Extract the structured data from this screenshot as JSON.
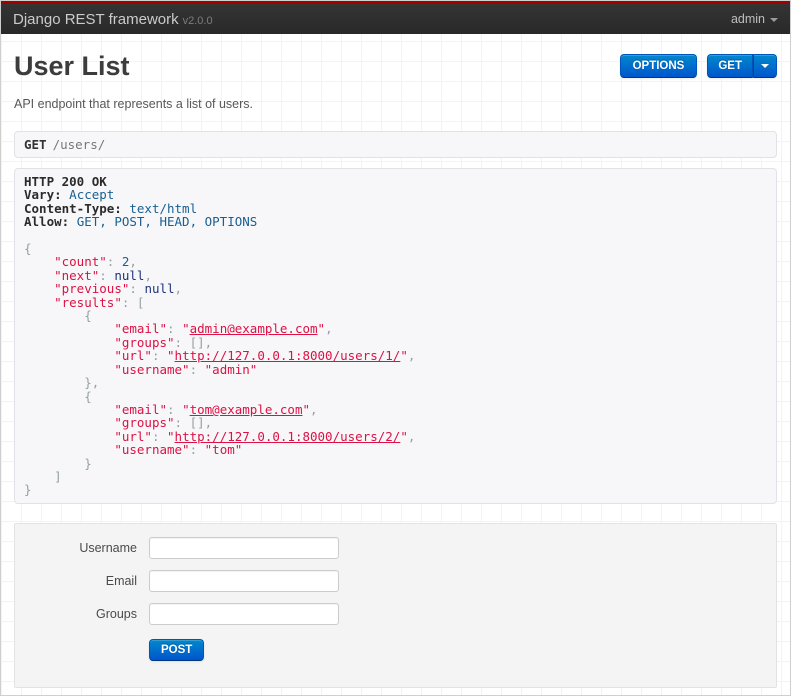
{
  "navbar": {
    "brand": "Django REST framework",
    "version": "v2.0.0",
    "user_menu": "admin"
  },
  "page": {
    "title": "User List",
    "description": "API endpoint that represents a list of users."
  },
  "toolbar": {
    "options_label": "OPTIONS",
    "get_label": "GET"
  },
  "request": {
    "method": "GET",
    "path": "/users/"
  },
  "response": {
    "status_line": "HTTP 200 OK",
    "headers": [
      {
        "name": "Vary:",
        "value": "Accept"
      },
      {
        "name": "Content-Type:",
        "value": "text/html"
      },
      {
        "name": "Allow:",
        "value": "GET, POST, HEAD, OPTIONS"
      }
    ],
    "body_lines": [
      [
        [
          "pun",
          "{"
        ]
      ],
      [
        [
          "pln",
          "    "
        ],
        [
          "str",
          "\"count\""
        ],
        [
          "pun",
          ": "
        ],
        [
          "lit",
          "2"
        ],
        [
          "pun",
          ","
        ]
      ],
      [
        [
          "pln",
          "    "
        ],
        [
          "str",
          "\"next\""
        ],
        [
          "pun",
          ": "
        ],
        [
          "kwd",
          "null"
        ],
        [
          "pun",
          ","
        ]
      ],
      [
        [
          "pln",
          "    "
        ],
        [
          "str",
          "\"previous\""
        ],
        [
          "pun",
          ": "
        ],
        [
          "kwd",
          "null"
        ],
        [
          "pun",
          ","
        ]
      ],
      [
        [
          "pln",
          "    "
        ],
        [
          "str",
          "\"results\""
        ],
        [
          "pun",
          ": ["
        ]
      ],
      [
        [
          "pln",
          "        "
        ],
        [
          "pun",
          "{"
        ]
      ],
      [
        [
          "pln",
          "            "
        ],
        [
          "str",
          "\"email\""
        ],
        [
          "pun",
          ": "
        ],
        [
          "str",
          "\""
        ],
        [
          "url",
          "admin@example.com"
        ],
        [
          "str",
          "\""
        ],
        [
          "pun",
          ","
        ]
      ],
      [
        [
          "pln",
          "            "
        ],
        [
          "str",
          "\"groups\""
        ],
        [
          "pun",
          ": [],"
        ]
      ],
      [
        [
          "pln",
          "            "
        ],
        [
          "str",
          "\"url\""
        ],
        [
          "pun",
          ": "
        ],
        [
          "str",
          "\""
        ],
        [
          "url",
          "http://127.0.0.1:8000/users/1/"
        ],
        [
          "str",
          "\""
        ],
        [
          "pun",
          ","
        ]
      ],
      [
        [
          "pln",
          "            "
        ],
        [
          "str",
          "\"username\""
        ],
        [
          "pun",
          ": "
        ],
        [
          "str",
          "\"admin\""
        ]
      ],
      [
        [
          "pln",
          "        "
        ],
        [
          "pun",
          "},"
        ]
      ],
      [
        [
          "pln",
          "        "
        ],
        [
          "pun",
          "{"
        ]
      ],
      [
        [
          "pln",
          "            "
        ],
        [
          "str",
          "\"email\""
        ],
        [
          "pun",
          ": "
        ],
        [
          "str",
          "\""
        ],
        [
          "url",
          "tom@example.com"
        ],
        [
          "str",
          "\""
        ],
        [
          "pun",
          ","
        ]
      ],
      [
        [
          "pln",
          "            "
        ],
        [
          "str",
          "\"groups\""
        ],
        [
          "pun",
          ": [],"
        ]
      ],
      [
        [
          "pln",
          "            "
        ],
        [
          "str",
          "\"url\""
        ],
        [
          "pun",
          ": "
        ],
        [
          "str",
          "\""
        ],
        [
          "url",
          "http://127.0.0.1:8000/users/2/"
        ],
        [
          "str",
          "\""
        ],
        [
          "pun",
          ","
        ]
      ],
      [
        [
          "pln",
          "            "
        ],
        [
          "str",
          "\"username\""
        ],
        [
          "pun",
          ": "
        ],
        [
          "str",
          "\"tom\""
        ]
      ],
      [
        [
          "pln",
          "        "
        ],
        [
          "pun",
          "}"
        ]
      ],
      [
        [
          "pln",
          "    "
        ],
        [
          "pun",
          "]"
        ]
      ],
      [
        [
          "pun",
          "}"
        ]
      ]
    ]
  },
  "form": {
    "fields": [
      {
        "name": "username",
        "label": "Username",
        "value": "",
        "placeholder": ""
      },
      {
        "name": "email",
        "label": "Email",
        "value": "",
        "placeholder": ""
      },
      {
        "name": "groups",
        "label": "Groups",
        "value": "",
        "placeholder": ""
      }
    ],
    "submit_label": "POST"
  },
  "colors": {
    "accent_bar": "#a30000",
    "navbar_bg": "#2e2e2e",
    "button_blue_top": "#0088cc",
    "button_blue_bottom": "#0055cc",
    "code_string": "#dd1144",
    "code_literal": "#195f91",
    "code_keyword": "#1e347b",
    "code_punctuation": "#93a1a1",
    "panel_bg": "#f4f4f4",
    "code_bg": "#f7f7f9"
  }
}
